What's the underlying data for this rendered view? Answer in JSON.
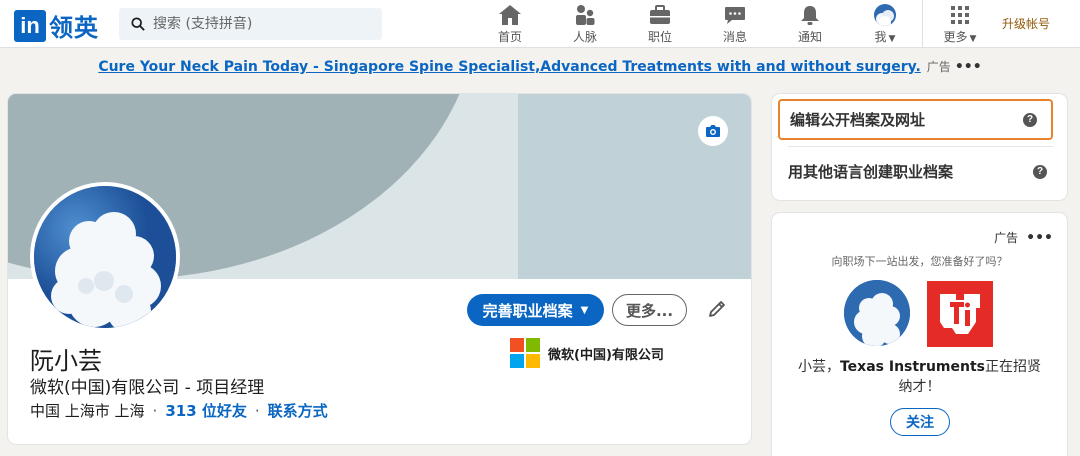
{
  "nav": {
    "logo_mark": "in",
    "logo_text": "领英",
    "search_placeholder": "搜索 (支持拼音)",
    "items": [
      {
        "label": "首页",
        "icon": "home-icon"
      },
      {
        "label": "人脉",
        "icon": "people-icon"
      },
      {
        "label": "职位",
        "icon": "briefcase-icon"
      },
      {
        "label": "消息",
        "icon": "message-icon"
      },
      {
        "label": "通知",
        "icon": "bell-icon"
      },
      {
        "label": "我",
        "icon": "avatar"
      },
      {
        "label": "更多",
        "icon": "grid-icon"
      }
    ],
    "upgrade": "升级帐号"
  },
  "ad_bar": {
    "link_text": "Cure Your Neck Pain Today - Singapore Spine Specialist,Advanced Treatments with and without surgery.",
    "ad_label": "广告",
    "dots": "•••"
  },
  "profile": {
    "name": "阮小芸",
    "headline": "微软(中国)有限公司 - 项目经理",
    "location": "中国 上海市 上海",
    "separator": "·",
    "connections": "313 位好友",
    "contact": "联系方式",
    "primary_button": "完善职业档案",
    "more_button": "更多...",
    "company": "微软(中国)有限公司"
  },
  "sidebar": {
    "edit_profile": "编辑公开档案及网址",
    "other_language": "用其他语言创建职业档案",
    "help_glyph": "?"
  },
  "ad_card": {
    "label": "广告",
    "dots": "•••",
    "tagline": "向职场下一站出发，您准备好了吗？",
    "message_pre": "小芸，",
    "message_company": "Texas Instruments",
    "message_post": "正在招贤纳才！",
    "follow": "关注"
  },
  "colors": {
    "accent": "#0a66c2",
    "highlight_border": "#e9812d",
    "ti_red": "#e42b27",
    "upgrade": "#915907"
  }
}
